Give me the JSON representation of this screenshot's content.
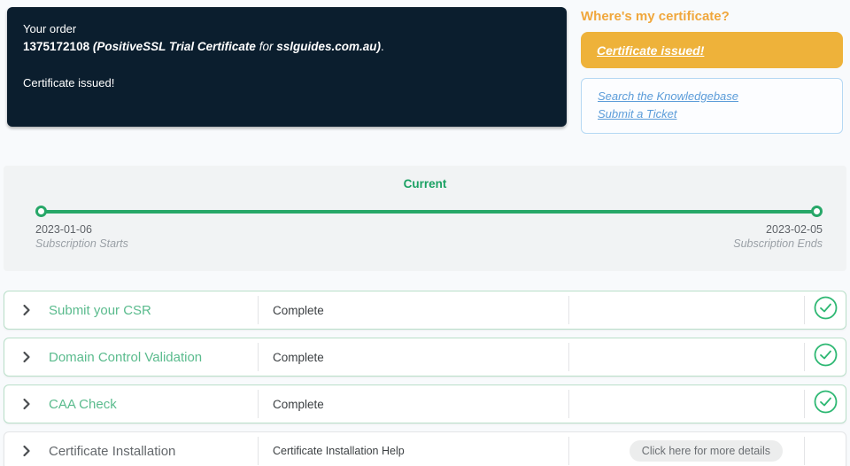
{
  "order_banner": {
    "label": "Your order",
    "order_id": "1375172108",
    "product_name": "(PositiveSSL Trial Certificate",
    "for_word": "for",
    "domain": "sslguides.com.au)",
    "suffix": ".",
    "status_text": "Certificate issued!"
  },
  "certificate_panel": {
    "heading": "Where's my certificate?",
    "status_button_label": "Certificate issued!",
    "links": [
      {
        "label": "Search the Knowledgebase"
      },
      {
        "label": "Submit a Ticket"
      }
    ]
  },
  "timeline": {
    "current_label": "Current",
    "start": {
      "date": "2023-01-06",
      "label": "Subscription Starts"
    },
    "end": {
      "date": "2023-02-05",
      "label": "Subscription Ends"
    }
  },
  "steps": [
    {
      "title": "Submit your CSR",
      "status": "Complete",
      "action": "",
      "complete": true
    },
    {
      "title": "Domain Control Validation",
      "status": "Complete",
      "action": "",
      "complete": true
    },
    {
      "title": "CAA Check",
      "status": "Complete",
      "action": "",
      "complete": true
    },
    {
      "title": "Certificate Installation",
      "status": "Certificate Installation Help",
      "action": "Click here for more details",
      "complete": false
    }
  ],
  "colors": {
    "dark_navy": "#0b1e2e",
    "orange_heading": "#f0a73c",
    "yellow_button": "#eeb23a",
    "link_blue": "#5b9cd9",
    "green_accent": "#27a768",
    "green_title": "#5abb8d",
    "green_check": "#2eb873"
  }
}
